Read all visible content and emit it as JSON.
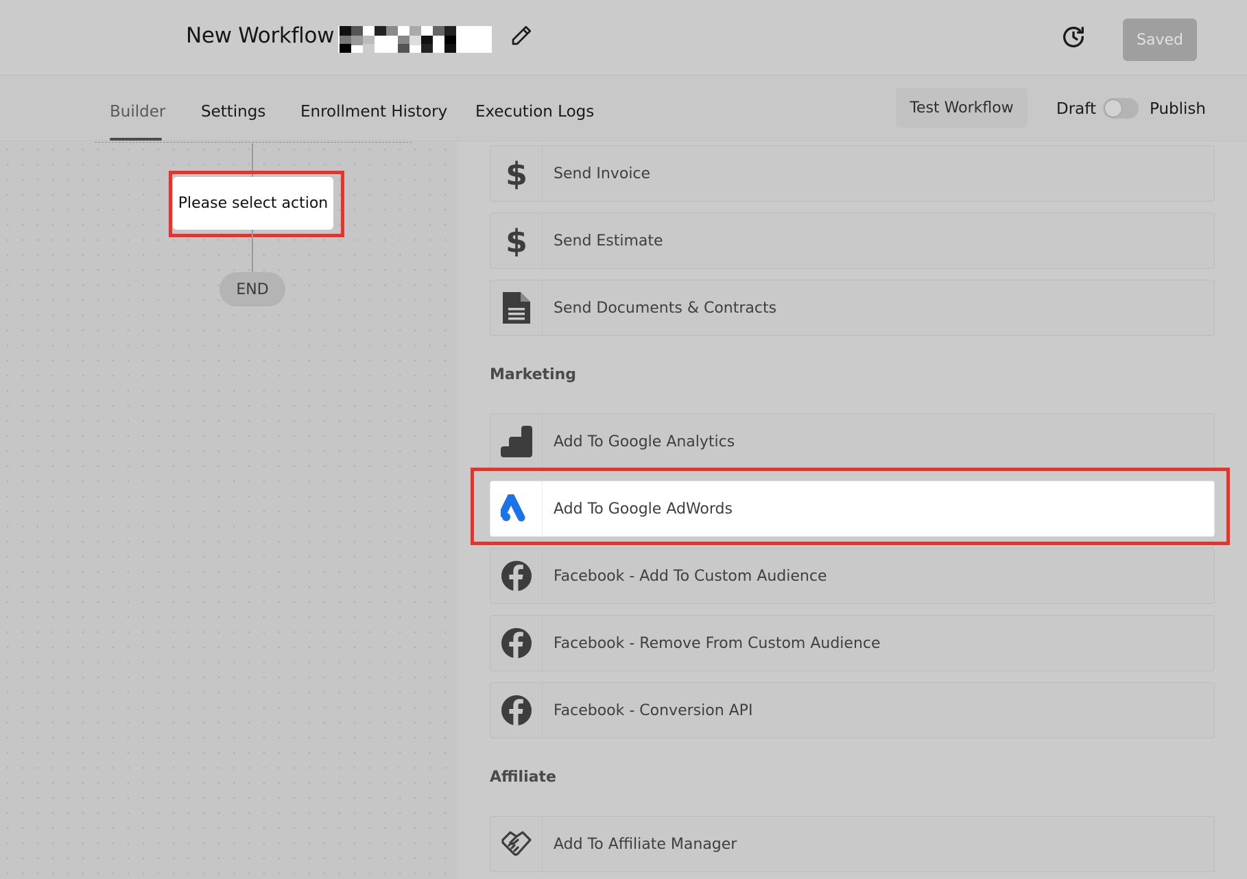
{
  "header": {
    "workflow_title": "New Workflow :",
    "saved_label": "Saved"
  },
  "tabs": [
    "Builder",
    "Settings",
    "Enrollment History",
    "Execution Logs"
  ],
  "toolbar": {
    "test_label": "Test Workflow",
    "draft_label": "Draft",
    "publish_label": "Publish",
    "published": false
  },
  "canvas": {
    "action_placeholder": "Please select action",
    "end_label": "END"
  },
  "actions": {
    "top_items": [
      {
        "label": "Send Invoice",
        "icon": "dollar-icon"
      },
      {
        "label": "Send Estimate",
        "icon": "dollar-icon"
      },
      {
        "label": "Send Documents & Contracts",
        "icon": "document-icon"
      }
    ],
    "marketing": {
      "title": "Marketing",
      "items": [
        {
          "label": "Add To Google Analytics",
          "icon": "analytics-icon"
        },
        {
          "label": "Add To Google AdWords",
          "icon": "google-ads-icon"
        },
        {
          "label": "Facebook - Add To Custom Audience",
          "icon": "facebook-icon"
        },
        {
          "label": "Facebook - Remove From Custom Audience",
          "icon": "facebook-icon"
        },
        {
          "label": "Facebook - Conversion API",
          "icon": "facebook-icon"
        }
      ]
    },
    "affiliate": {
      "title": "Affiliate",
      "items": [
        {
          "label": "Add To Affiliate Manager",
          "icon": "handshake-icon"
        }
      ]
    }
  },
  "colors": {
    "highlight_border": "#e8332a",
    "google_ads_blue": "#1a73e8",
    "icon_dark": "#3d3d3d"
  }
}
